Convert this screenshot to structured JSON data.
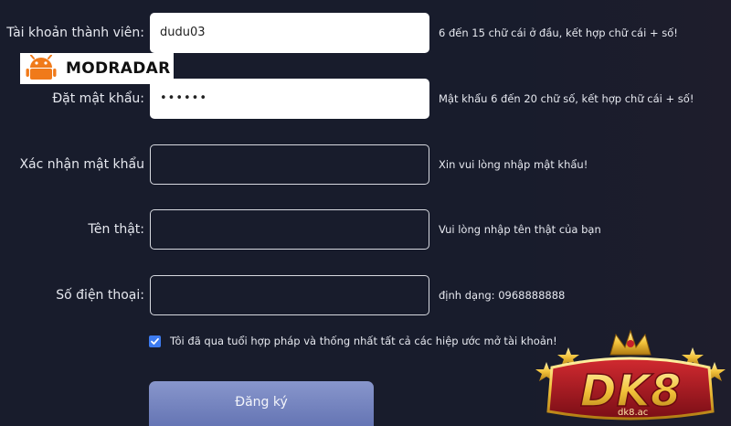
{
  "form": {
    "fields": [
      {
        "label": "Tài khoản thành viên:",
        "value": "dudu03",
        "hint": "6 đến 15 chữ cái ở đầu, kết hợp chữ cái + số!"
      },
      {
        "label": "Đặt mật khẩu:",
        "value": "••••••",
        "hint": "Mật khẩu 6 đến 20 chữ số, kết hợp chữ cái + số!"
      },
      {
        "label": "Xác nhận mật khẩu",
        "value": "",
        "hint": "Xin vui lòng nhập mật khẩu!"
      },
      {
        "label": "Tên thật:",
        "value": "",
        "hint": "Vui lòng nhập tên thật của bạn"
      },
      {
        "label": "Số điện thoại:",
        "value": "",
        "hint": "định dạng: 0968888888"
      }
    ],
    "agree_text": "Tôi đã qua tuổi hợp pháp và thống nhất tất cả các hiệp ước mở tài khoản!",
    "agree_checked": true,
    "submit_label": "Đăng ký"
  },
  "watermark": {
    "text": "MODRADAR",
    "icon": "android-icon"
  },
  "brand_logo": {
    "text": "DK8",
    "subtext": "dk8.ac"
  },
  "colors": {
    "background": "#181c2c",
    "field_border": "#d7d9e0",
    "checkbox": "#3d7bf0",
    "button": "#7584c2",
    "logo_gold": "#f2c23a",
    "logo_red": "#9a1420"
  }
}
